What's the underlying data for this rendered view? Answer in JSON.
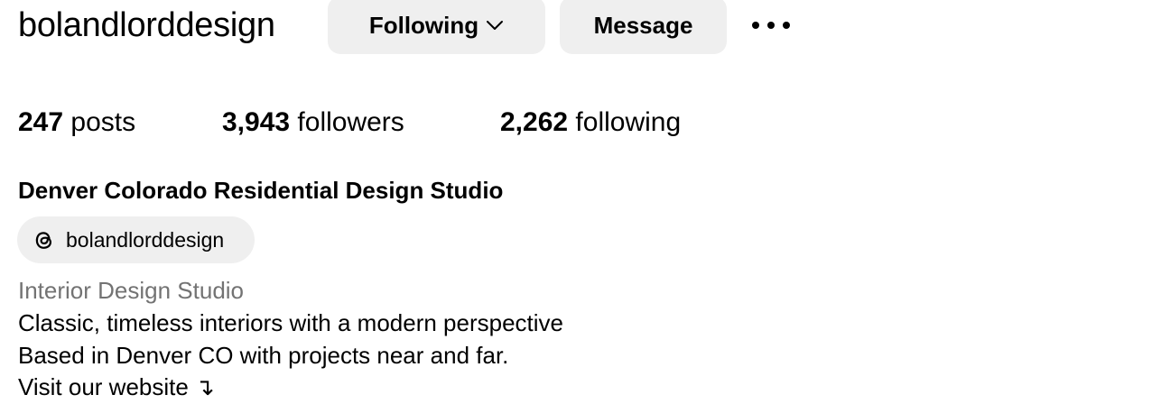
{
  "profile": {
    "username": "bolandlorddesign",
    "following_button_label": "Following",
    "message_button_label": "Message",
    "more_icon": "more-horizontal-icon"
  },
  "stats": {
    "posts_count": "247",
    "posts_label": "posts",
    "followers_count": "3,943",
    "followers_label": "followers",
    "following_count": "2,262",
    "following_label": "following"
  },
  "bio": {
    "display_name": "Denver Colorado Residential Design Studio",
    "threads_handle": "bolandlorddesign",
    "threads_icon": "threads-icon",
    "category": "Interior Design Studio",
    "line1": "Classic, timeless interiors with a modern perspective",
    "line2": "Based in Denver CO with projects near and far.",
    "line3": "Visit our website ↴"
  },
  "colors": {
    "button_bg": "#efefef",
    "category_text": "#737373",
    "text": "#000000"
  }
}
